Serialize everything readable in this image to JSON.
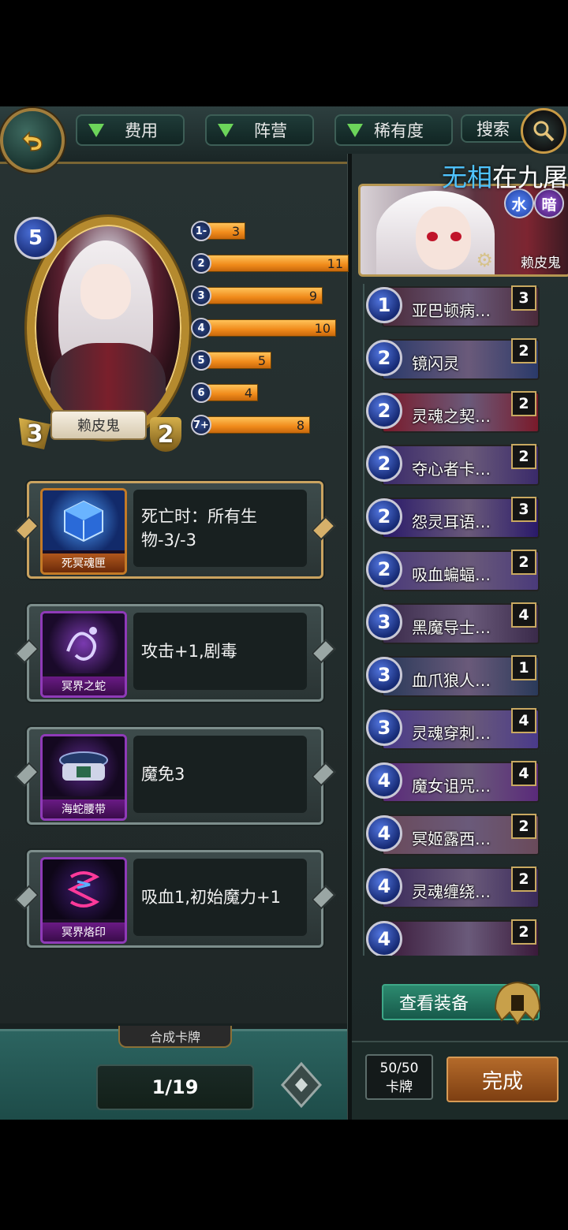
{
  "filters": {
    "cost": "费用",
    "faction": "阵营",
    "rarity": "稀有度",
    "search": "搜索"
  },
  "icons": {
    "back": "back-arrow-icon",
    "search": "magnifier-icon",
    "next": "next-arrow-icon",
    "helmet": "golden-helmet-icon"
  },
  "hero": {
    "name": "赖皮鬼",
    "cost": "5",
    "attack": "3",
    "health": "2"
  },
  "mana_curve": [
    {
      "label": "1-",
      "count": "3",
      "value": 3
    },
    {
      "label": "2",
      "count": "11",
      "value": 11
    },
    {
      "label": "3",
      "count": "9",
      "value": 9
    },
    {
      "label": "4",
      "count": "10",
      "value": 10
    },
    {
      "label": "5",
      "count": "5",
      "value": 5
    },
    {
      "label": "6",
      "count": "4",
      "value": 4
    },
    {
      "label": "7+",
      "count": "8",
      "value": 8
    }
  ],
  "equipment": [
    {
      "name": "死冥魂匣",
      "desc": "死亡时：所有生物-3/-3",
      "rarity": "gold"
    },
    {
      "name": "冥界之蛇",
      "desc": "攻击+1,剧毒",
      "rarity": "epic"
    },
    {
      "name": "海蛇腰带",
      "desc": "魔免3",
      "rarity": "epic"
    },
    {
      "name": "冥界烙印",
      "desc": "吸血1,初始魔力+1",
      "rarity": "epic"
    }
  ],
  "craft_tab": "合成卡牌",
  "pager": "1/19",
  "deck": {
    "title_prefix": "无相",
    "title_rest": "在九屠",
    "elements": {
      "water": "水",
      "dark": "暗"
    },
    "hero_name": "赖皮鬼",
    "cards": [
      {
        "cost": "1",
        "name": "亚巴顿病…",
        "count": "3",
        "color": "#4b2a3a"
      },
      {
        "cost": "2",
        "name": "镜闪灵",
        "count": "2",
        "color": "#2a3a6a"
      },
      {
        "cost": "2",
        "name": "灵魂之契…",
        "count": "2",
        "color": "#7a1a2a"
      },
      {
        "cost": "2",
        "name": "夺心者卡…",
        "count": "2",
        "color": "#3a2a6a"
      },
      {
        "cost": "2",
        "name": "怨灵耳语…",
        "count": "3",
        "color": "#2a1a6a"
      },
      {
        "cost": "2",
        "name": "吸血蝙蝠…",
        "count": "2",
        "color": "#4a3a7a"
      },
      {
        "cost": "3",
        "name": "黑魔导士…",
        "count": "4",
        "color": "#3a2a4a"
      },
      {
        "cost": "3",
        "name": "血爪狼人…",
        "count": "1",
        "color": "#2a3a5a"
      },
      {
        "cost": "3",
        "name": "灵魂穿刺…",
        "count": "4",
        "color": "#4a3a8a"
      },
      {
        "cost": "4",
        "name": "魔女诅咒…",
        "count": "4",
        "color": "#5a2a7a"
      },
      {
        "cost": "4",
        "name": "冥姬露西…",
        "count": "2",
        "color": "#6a4a5a"
      },
      {
        "cost": "4",
        "name": "灵魂缠绕…",
        "count": "2",
        "color": "#3a2a5a"
      },
      {
        "cost": "4",
        "name": "",
        "count": "2",
        "color": "#3a1a3a"
      }
    ]
  },
  "view_equipment": "查看装备",
  "card_count": {
    "value": "50/50",
    "label": "卡牌"
  },
  "done": "完成"
}
